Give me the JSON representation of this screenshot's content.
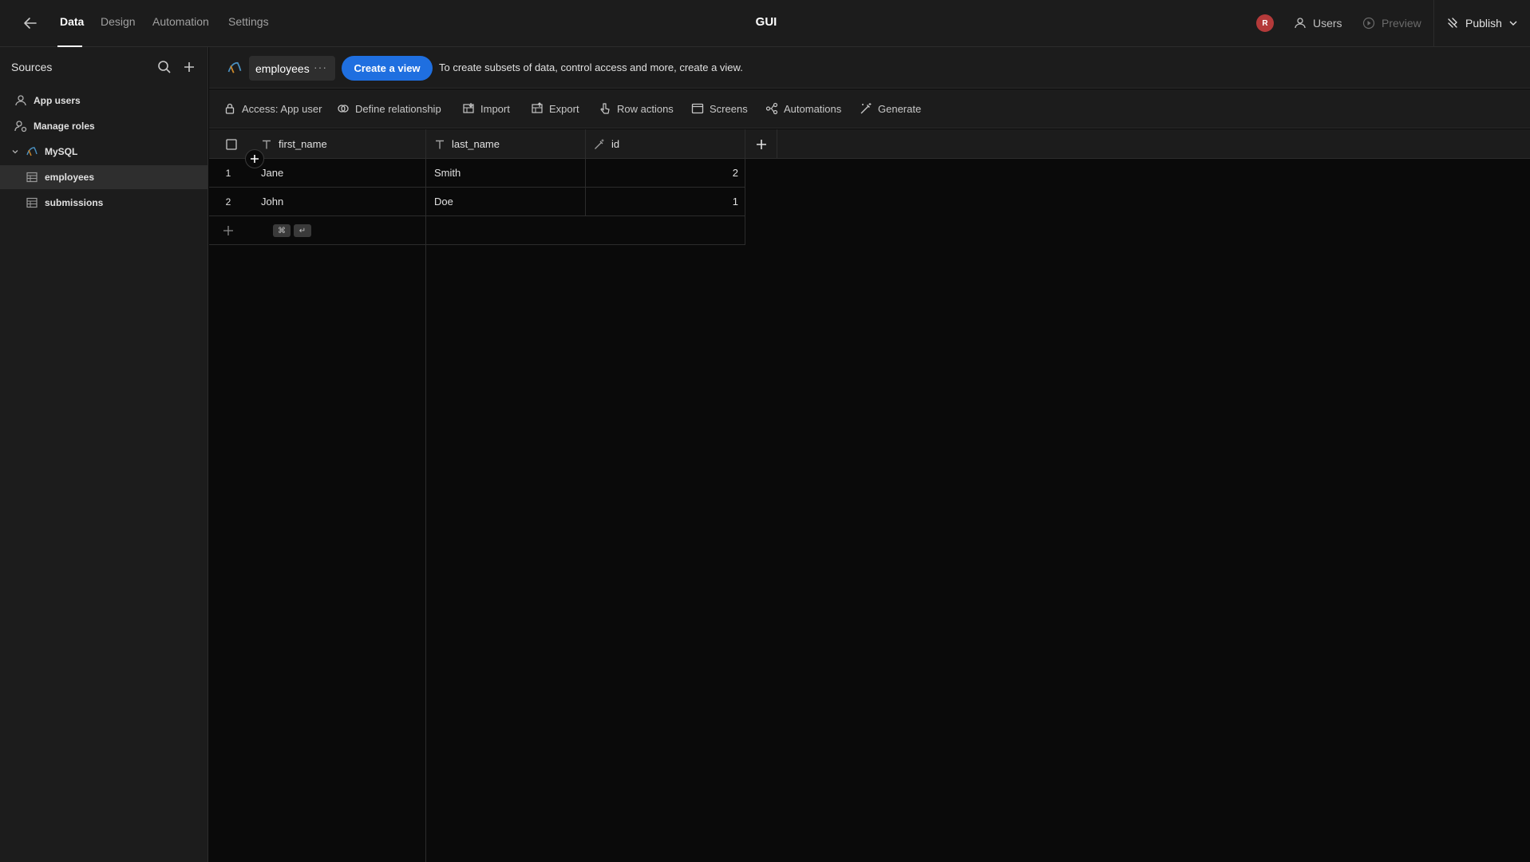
{
  "topbar": {
    "tabs": [
      {
        "label": "Data",
        "active": true
      },
      {
        "label": "Design",
        "active": false
      },
      {
        "label": "Automation",
        "active": false
      },
      {
        "label": "Settings",
        "active": false
      }
    ],
    "app_title": "GUI",
    "avatar_initial": "R",
    "users_label": "Users",
    "preview_label": "Preview",
    "publish_label": "Publish"
  },
  "sidebar": {
    "title": "Sources",
    "items": [
      {
        "label": "App users",
        "icon": "user-icon"
      },
      {
        "label": "Manage roles",
        "icon": "roles-icon"
      },
      {
        "label": "MySQL",
        "icon": "mysql-icon",
        "expanded": true
      },
      {
        "label": "employees",
        "icon": "table-icon",
        "selected": true
      },
      {
        "label": "submissions",
        "icon": "table-icon"
      }
    ]
  },
  "toolbar": {
    "table_name": "employees",
    "more_label": "···",
    "create_view_label": "Create a view",
    "hint": "To create subsets of data, control access and more, create a view.",
    "actions": [
      {
        "label": "Access: App user",
        "icon": "lock-icon"
      },
      {
        "label": "Define relationship",
        "icon": "relationship-icon"
      },
      {
        "label": "Import",
        "icon": "import-icon"
      },
      {
        "label": "Export",
        "icon": "export-icon"
      },
      {
        "label": "Row actions",
        "icon": "pointer-icon"
      },
      {
        "label": "Screens",
        "icon": "screen-icon"
      },
      {
        "label": "Automations",
        "icon": "automation-icon"
      },
      {
        "label": "Generate",
        "icon": "magic-wand-icon"
      }
    ]
  },
  "grid": {
    "columns": [
      {
        "name": "first_name",
        "type_icon": "text-type-icon"
      },
      {
        "name": "last_name",
        "type_icon": "text-type-icon"
      },
      {
        "name": "id",
        "type_icon": "auto-id-icon"
      }
    ],
    "rows": [
      {
        "num": "1",
        "first_name": "Jane",
        "last_name": "Smith",
        "id": "2"
      },
      {
        "num": "2",
        "first_name": "John",
        "last_name": "Doe",
        "id": "1"
      }
    ],
    "shortcut_keys": [
      "⌘",
      "↵"
    ]
  },
  "colors": {
    "accent": "#1f6fe0",
    "avatar": "#b43a3a",
    "background": "#0a0a0a",
    "panel": "#1c1c1c"
  }
}
